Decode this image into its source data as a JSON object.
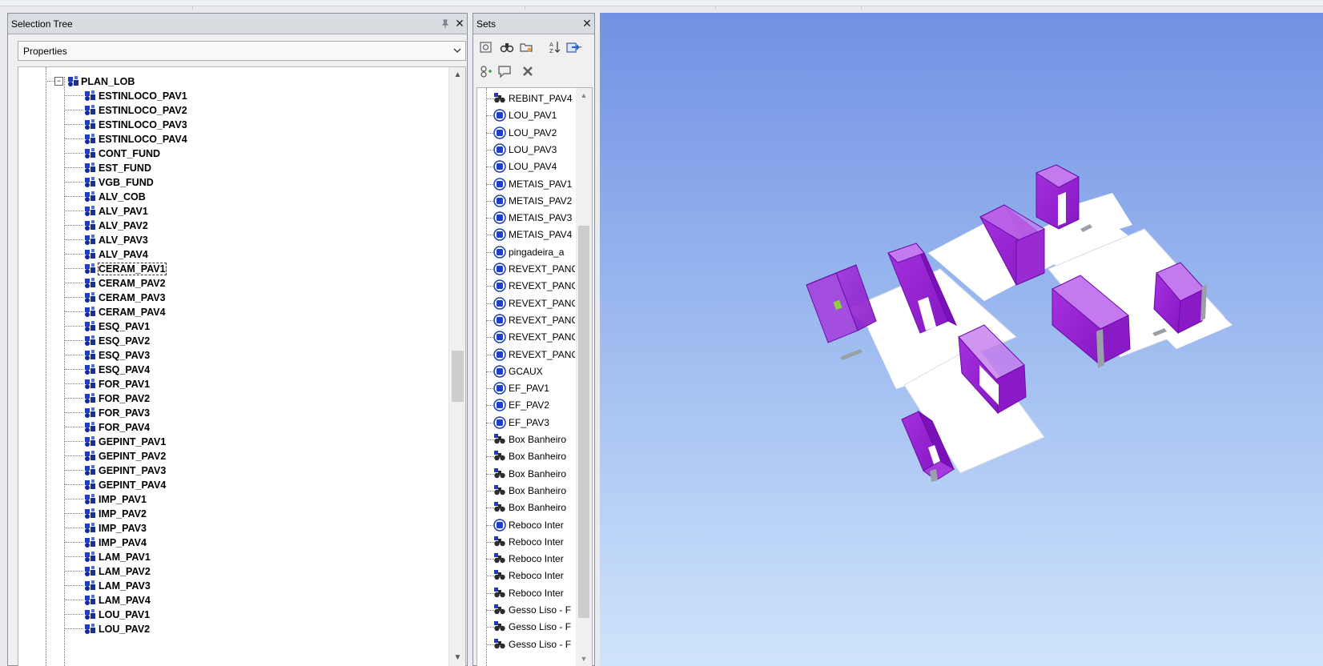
{
  "selection_tree": {
    "title": "Selection Tree",
    "pin_icon": "pin-icon",
    "close_label": "✕",
    "dropdown_value": "Properties",
    "root": {
      "toggle": "−",
      "label": "PLAN_LOB"
    },
    "items": [
      "ESTINLOCO_PAV1",
      "ESTINLOCO_PAV2",
      "ESTINLOCO_PAV3",
      "ESTINLOCO_PAV4",
      "CONT_FUND",
      "EST_FUND",
      "VGB_FUND",
      "ALV_COB",
      "ALV_PAV1",
      "ALV_PAV2",
      "ALV_PAV3",
      "ALV_PAV4",
      "CERAM_PAV1",
      "CERAM_PAV2",
      "CERAM_PAV3",
      "CERAM_PAV4",
      "ESQ_PAV1",
      "ESQ_PAV2",
      "ESQ_PAV3",
      "ESQ_PAV4",
      "FOR_PAV1",
      "FOR_PAV2",
      "FOR_PAV3",
      "FOR_PAV4",
      "GEPINT_PAV1",
      "GEPINT_PAV2",
      "GEPINT_PAV3",
      "GEPINT_PAV4",
      "IMP_PAV1",
      "IMP_PAV2",
      "IMP_PAV3",
      "IMP_PAV4",
      "LAM_PAV1",
      "LAM_PAV2",
      "LAM_PAV3",
      "LAM_PAV4",
      "LOU_PAV1",
      "LOU_PAV2"
    ],
    "focused_item": "CERAM_PAV1"
  },
  "sets": {
    "title": "Sets",
    "close_label": "✕",
    "toolbar_icons": [
      "save-selection-icon",
      "save-search-icon",
      "new-folder-icon",
      "sort-icon",
      "import-export-icon",
      "add-comment-icon",
      "comment-icon",
      "delete-icon"
    ],
    "items": [
      {
        "label": "REBINT_PAV4",
        "type": "search"
      },
      {
        "label": "LOU_PAV1",
        "type": "selection"
      },
      {
        "label": "LOU_PAV2",
        "type": "selection"
      },
      {
        "label": "LOU_PAV3",
        "type": "selection"
      },
      {
        "label": "LOU_PAV4",
        "type": "selection"
      },
      {
        "label": "METAIS_PAV1",
        "type": "selection"
      },
      {
        "label": "METAIS_PAV2",
        "type": "selection"
      },
      {
        "label": "METAIS_PAV3",
        "type": "selection"
      },
      {
        "label": "METAIS_PAV4",
        "type": "selection"
      },
      {
        "label": "pingadeira_a",
        "type": "selection"
      },
      {
        "label": "REVEXT_PANC",
        "type": "selection"
      },
      {
        "label": "REVEXT_PANC",
        "type": "selection"
      },
      {
        "label": "REVEXT_PANC",
        "type": "selection"
      },
      {
        "label": "REVEXT_PANC",
        "type": "selection"
      },
      {
        "label": "REVEXT_PANC",
        "type": "selection"
      },
      {
        "label": "REVEXT_PANC",
        "type": "selection"
      },
      {
        "label": "GCAUX",
        "type": "selection"
      },
      {
        "label": "EF_PAV1",
        "type": "selection"
      },
      {
        "label": "EF_PAV2",
        "type": "selection"
      },
      {
        "label": "EF_PAV3",
        "type": "selection"
      },
      {
        "label": "Box Banheiro",
        "type": "search"
      },
      {
        "label": "Box Banheiro",
        "type": "search"
      },
      {
        "label": "Box Banheiro",
        "type": "search"
      },
      {
        "label": "Box Banheiro",
        "type": "search"
      },
      {
        "label": "Box Banheiro",
        "type": "search"
      },
      {
        "label": "Reboco Inter",
        "type": "selection"
      },
      {
        "label": "Reboco Inter",
        "type": "search"
      },
      {
        "label": "Reboco Inter",
        "type": "search"
      },
      {
        "label": "Reboco Inter",
        "type": "search"
      },
      {
        "label": "Reboco Inter",
        "type": "search"
      },
      {
        "label": "Gesso Liso - F",
        "type": "search"
      },
      {
        "label": "Gesso Liso - F",
        "type": "search"
      },
      {
        "label": "Gesso Liso - F",
        "type": "search"
      }
    ]
  },
  "viewport": {
    "model_color": "#9a1fd6",
    "slab_color": "#ffffff"
  }
}
